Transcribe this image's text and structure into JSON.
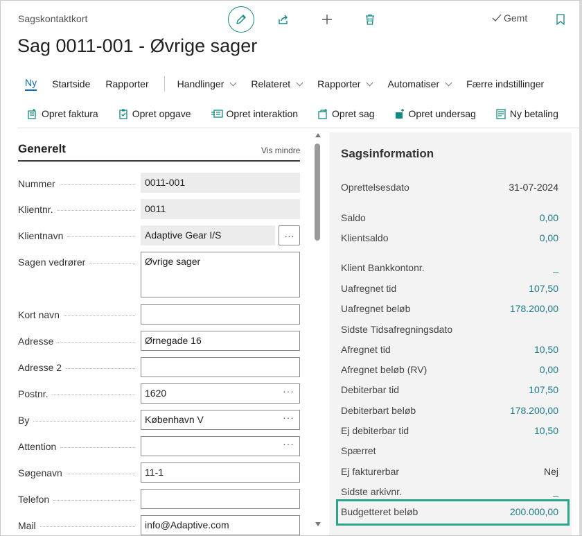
{
  "header": {
    "page_type": "Sagskontaktkort",
    "title": "Sag 0011-001 - Øvrige sager",
    "saved_label": "Gemt"
  },
  "actions": {
    "new": "Ny",
    "home": "Startside",
    "reports": "Rapporter",
    "actions": "Handlinger",
    "related": "Relateret",
    "reports2": "Rapporter",
    "automate": "Automatiser",
    "fewer": "Færre indstillinger"
  },
  "promoted": {
    "create_invoice": "Opret faktura",
    "create_task": "Opret opgave",
    "create_interaction": "Opret interaktion",
    "create_case": "Opret sag",
    "create_subcase": "Opret undersag",
    "new_payment": "Ny betaling"
  },
  "general": {
    "title": "Generelt",
    "show_less": "Vis mindre",
    "fields": {
      "number": {
        "label": "Nummer",
        "value": "0011-001"
      },
      "client_no": {
        "label": "Klientnr.",
        "value": "0011"
      },
      "client_name": {
        "label": "Klientnavn",
        "value": "Adaptive Gear I/S"
      },
      "regarding": {
        "label": "Sagen vedrører",
        "value": "Øvrige sager"
      },
      "short_name": {
        "label": "Kort navn",
        "value": ""
      },
      "address": {
        "label": "Adresse",
        "value": "Ørnegade 16"
      },
      "address2": {
        "label": "Adresse 2",
        "value": ""
      },
      "postcode": {
        "label": "Postnr.",
        "value": "1620"
      },
      "city": {
        "label": "By",
        "value": "København V"
      },
      "attention": {
        "label": "Attention",
        "value": ""
      },
      "search_name": {
        "label": "Søgenavn",
        "value": "11-1"
      },
      "phone": {
        "label": "Telefon",
        "value": ""
      },
      "mail": {
        "label": "Mail",
        "value": "info@Adaptive.com"
      }
    },
    "ellipsis": "···"
  },
  "factbox": {
    "title": "Sagsinformation",
    "rows": [
      {
        "label": "Oprettelsesdato",
        "value": "31-07-2024"
      },
      {
        "label": "Saldo",
        "value": "0,00"
      },
      {
        "label": "Klientsaldo",
        "value": "0,00"
      },
      {
        "label": "Klient Bankkontonr.",
        "value": "_"
      },
      {
        "label": "Uafregnet tid",
        "value": "107,50"
      },
      {
        "label": "Uafregnet beløb",
        "value": "178.200,00"
      },
      {
        "label": "Sidste Tidsafregningsdato",
        "value": ""
      },
      {
        "label": "Afregnet tid",
        "value": "10,50"
      },
      {
        "label": "Afregnet beløb (RV)",
        "value": "0,00"
      },
      {
        "label": "Debiterbar tid",
        "value": "107,50"
      },
      {
        "label": "Debiterbart beløb",
        "value": "178.200,00"
      },
      {
        "label": "Ej debiterbar tid",
        "value": "10,50"
      },
      {
        "label": "Spærret",
        "value": ""
      },
      {
        "label": "Ej fakturerbar",
        "value": "Nej"
      },
      {
        "label": "Sidste arkivnr.",
        "value": "_"
      },
      {
        "label": "Budgetteret beløb",
        "value": "200.000,00"
      }
    ]
  },
  "colors": {
    "accent": "#0f8a82",
    "link": "#1a7a87",
    "highlight": "#2aa58a"
  }
}
